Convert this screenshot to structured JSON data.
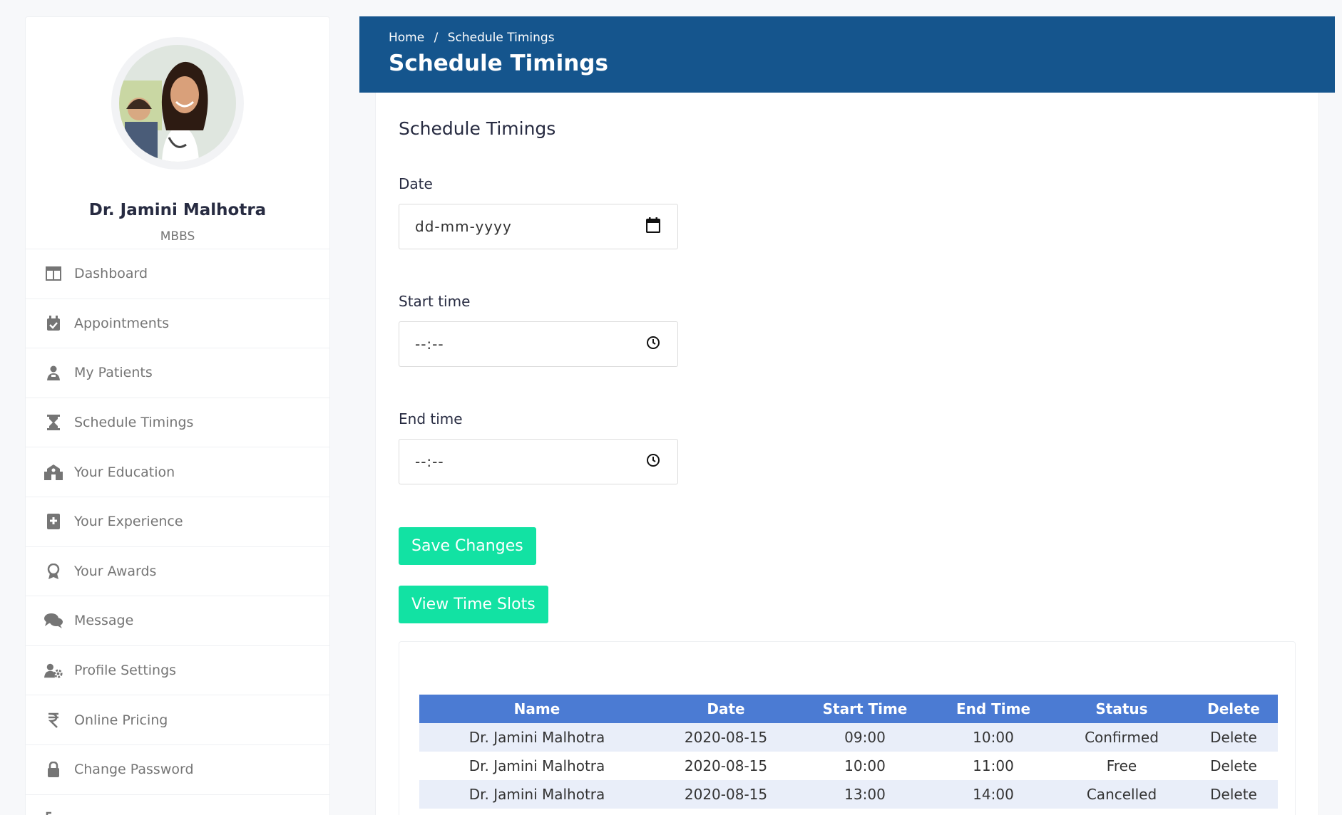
{
  "profile": {
    "name": "Dr. Jamini Malhotra",
    "degree": "MBBS"
  },
  "sidebar": {
    "items": [
      {
        "label": "Dashboard",
        "icon": "dashboard-icon"
      },
      {
        "label": "Appointments",
        "icon": "calendar-check-icon"
      },
      {
        "label": "My Patients",
        "icon": "patients-icon"
      },
      {
        "label": "Schedule Timings",
        "icon": "hourglass-icon"
      },
      {
        "label": "Your Education",
        "icon": "school-icon"
      },
      {
        "label": "Your Experience",
        "icon": "medical-book-icon"
      },
      {
        "label": "Your Awards",
        "icon": "award-icon"
      },
      {
        "label": "Message",
        "icon": "comments-icon"
      },
      {
        "label": "Profile Settings",
        "icon": "user-cog-icon"
      },
      {
        "label": "Online Pricing",
        "icon": "rupee-icon"
      },
      {
        "label": "Change Password",
        "icon": "lock-icon"
      }
    ]
  },
  "header": {
    "breadcrumb": [
      "Home",
      "/",
      "Schedule Timings"
    ],
    "title": "Schedule Timings"
  },
  "form": {
    "title": "Schedule Timings",
    "date_label": "Date",
    "date_placeholder": "dd-mm-yyyy",
    "start_label": "Start time",
    "start_placeholder": "--:--",
    "end_label": "End time",
    "end_placeholder": "--:--",
    "save_label": "Save Changes",
    "view_label": "View Time Slots"
  },
  "table": {
    "headers": [
      "Name",
      "Date",
      "Start Time",
      "End Time",
      "Status",
      "Delete"
    ],
    "rows": [
      [
        "Dr. Jamini Malhotra",
        "2020-08-15",
        "09:00",
        "10:00",
        "Confirmed",
        "Delete"
      ],
      [
        "Dr. Jamini Malhotra",
        "2020-08-15",
        "10:00",
        "11:00",
        "Free",
        "Delete"
      ],
      [
        "Dr. Jamini Malhotra",
        "2020-08-15",
        "13:00",
        "14:00",
        "Cancelled",
        "Delete"
      ]
    ]
  },
  "colors": {
    "brand": "#15558d",
    "accent": "#12e2a3",
    "table_header": "#4b7bd3"
  }
}
